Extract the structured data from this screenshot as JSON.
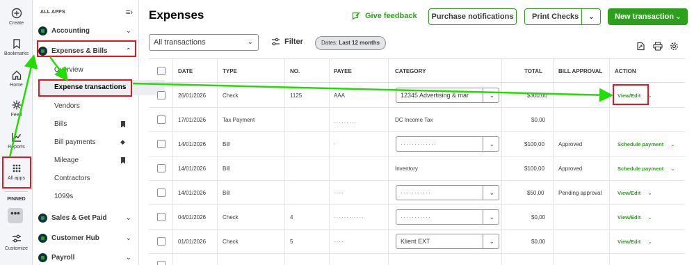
{
  "rail": {
    "items": [
      {
        "label": "Create",
        "icon": "plus-circle-icon"
      },
      {
        "label": "Bookmarks",
        "icon": "bookmark-icon"
      },
      {
        "label": "Home",
        "icon": "home-icon"
      },
      {
        "label": "Feed",
        "icon": "sparkle-icon"
      },
      {
        "label": "Reports",
        "icon": "chart-line-icon"
      },
      {
        "label": "All apps",
        "icon": "grid-icon"
      }
    ],
    "pinned_label": "PINNED",
    "pinned_more": "•••",
    "customize_label": "Customize"
  },
  "menu": {
    "header": "ALL APPS",
    "groups": {
      "accounting": "Accounting",
      "expenses": "Expenses & Bills",
      "sales": "Sales & Get Paid",
      "customer_hub": "Customer Hub",
      "payroll": "Payroll"
    },
    "subitems": [
      "Overview",
      "Expense transactions",
      "Vendors",
      "Bills",
      "Bill payments",
      "Mileage",
      "Contractors",
      "1099s"
    ]
  },
  "header": {
    "title": "Expenses",
    "feedback": "Give feedback",
    "purchase_notifications": "Purchase notifications",
    "print_checks": "Print Checks",
    "new_transaction": "New transaction"
  },
  "filters": {
    "transactions_select": "All transactions",
    "filter_label": "Filter",
    "dates_prefix": "Dates: ",
    "dates_value": "Last 12 months"
  },
  "table": {
    "columns": [
      "DATE",
      "TYPE",
      "NO.",
      "PAYEE",
      "CATEGORY",
      "TOTAL",
      "BILL APPROVAL",
      "ACTION"
    ],
    "rows": [
      {
        "date": "26/01/2026",
        "type": "Check",
        "no": "1125",
        "payee": "AAA",
        "category": "12345 Advertising & mar",
        "category_is_select": true,
        "total": "$300,00",
        "approval": "",
        "action": "View/Edit"
      },
      {
        "date": "17/01/2026",
        "type": "Tax Payment",
        "no": "",
        "payee": "",
        "category": "DC Income Tax",
        "category_is_select": false,
        "total": "$0,00",
        "approval": "",
        "action": ""
      },
      {
        "date": "14/01/2026",
        "type": "Bill",
        "no": "",
        "payee": "",
        "category": "",
        "category_is_select": true,
        "total": "$100,00",
        "approval": "Approved",
        "action": "Schedule payment"
      },
      {
        "date": "14/01/2026",
        "type": "Bill",
        "no": "",
        "payee": "",
        "category": "Inventory",
        "category_is_select": false,
        "total": "$100,00",
        "approval": "Approved",
        "action": "Schedule payment"
      },
      {
        "date": "14/01/2026",
        "type": "Bill",
        "no": "",
        "payee": "",
        "category": "",
        "category_is_select": true,
        "total": "$50,00",
        "approval": "Pending approval",
        "action": "View/Edit"
      },
      {
        "date": "04/01/2026",
        "type": "Check",
        "no": "4",
        "payee": "",
        "category": "",
        "category_is_select": true,
        "total": "$0,00",
        "approval": "",
        "action": "View/Edit"
      },
      {
        "date": "01/01/2026",
        "type": "Check",
        "no": "5",
        "payee": "",
        "category": "Klient EXT",
        "category_is_select": true,
        "total": "$0,00",
        "approval": "",
        "action": "View/Edit"
      }
    ]
  },
  "colors": {
    "brand_green": "#2ca01c",
    "annotation_red": "#e8141e",
    "annotation_arrow": "#22dd00"
  }
}
